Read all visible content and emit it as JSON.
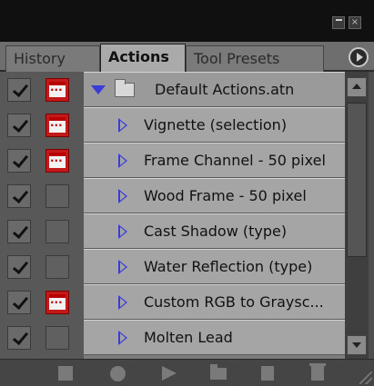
{
  "window": {
    "minimize_icon": "minimize-icon",
    "close_icon": "close-icon",
    "close_glyph": "×"
  },
  "tabs": [
    {
      "label": "History",
      "active": false
    },
    {
      "label": "Actions",
      "active": true
    },
    {
      "label": "Tool Presets",
      "active": false
    }
  ],
  "panel_menu_icon": "panel-menu-arrow-icon",
  "action_set": {
    "label": "Default Actions.atn",
    "expanded": true,
    "checked": true,
    "dialog_toggle": true
  },
  "actions": [
    {
      "label": "Vignette (selection)",
      "checked": true,
      "dialog_toggle": true
    },
    {
      "label": "Frame Channel - 50 pixel",
      "checked": true,
      "dialog_toggle": true
    },
    {
      "label": "Wood Frame - 50 pixel",
      "checked": true,
      "dialog_toggle": false
    },
    {
      "label": "Cast Shadow (type)",
      "checked": true,
      "dialog_toggle": false
    },
    {
      "label": "Water Reflection (type)",
      "checked": true,
      "dialog_toggle": false
    },
    {
      "label": "Custom RGB to Graysc...",
      "checked": true,
      "dialog_toggle": true
    },
    {
      "label": "Molten Lead",
      "checked": true,
      "dialog_toggle": false
    }
  ],
  "toolbar": {
    "icons": [
      "stop-icon",
      "record-icon",
      "play-icon",
      "new-set-icon",
      "new-action-icon",
      "delete-icon"
    ]
  },
  "colors": {
    "accent_triangle": "#3b3bd8",
    "dialog_toggle_on": "#c21a1a",
    "row_background": "#a5a5a5",
    "panel_background": "#4f4f4f"
  }
}
